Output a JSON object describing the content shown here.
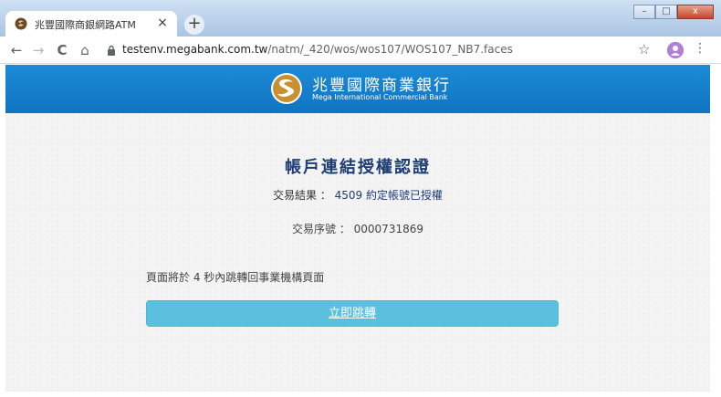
{
  "browser": {
    "tab_title": "兆豐國際商銀網路ATM",
    "tab_close": "×",
    "new_tab": "+",
    "url_host": "testenv.megabank.com.tw",
    "url_path": "/natm/_420/wos/wos107/WOS107_NB7.faces",
    "window_controls": {
      "minimize": "–",
      "maximize": "□",
      "close": "x"
    },
    "nav": {
      "back": "←",
      "forward": "→",
      "reload": "C",
      "home": "⌂"
    },
    "star": "☆",
    "menu": "⋮"
  },
  "bank": {
    "name_zh": "兆豐國際商業銀行",
    "name_en": "Mega International Commercial Bank",
    "header_color": "#1580c9"
  },
  "page": {
    "heading": "帳戶連結授權認證",
    "result_label": "交易結果 ：",
    "result_value": "4509 約定帳號已授權",
    "serial_label": "交易序號 ：",
    "serial_value": "0000731869",
    "redirect_text": "頁面將於 4 秒內跳轉回事業機構頁面",
    "redirect_button": "立即跳轉",
    "button_color": "#5bc0de"
  }
}
